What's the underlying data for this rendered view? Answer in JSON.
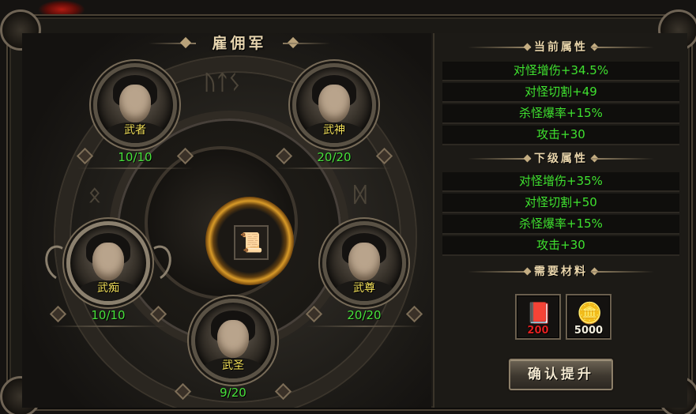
{
  "window": {
    "title": "雇佣军"
  },
  "center": {
    "item_icon": "scroll-icon"
  },
  "heroes": [
    {
      "name": "武者",
      "level": "10/10",
      "special": false
    },
    {
      "name": "武神",
      "level": "20/20",
      "special": false
    },
    {
      "name": "武痴",
      "level": "10/10",
      "special": true
    },
    {
      "name": "武尊",
      "level": "20/20",
      "special": false
    },
    {
      "name": "武圣",
      "level": "9/20",
      "special": false
    }
  ],
  "current_attrs": {
    "header": "当前属性",
    "items": [
      "对怪增伤+34.5%",
      "对怪切割+49",
      "杀怪爆率+15%",
      "攻击+30"
    ]
  },
  "next_attrs": {
    "header": "下级属性",
    "items": [
      "对怪增伤+35%",
      "对怪切割+50",
      "杀怪爆率+15%",
      "攻击+30"
    ]
  },
  "materials": {
    "header": "需要材料",
    "items": [
      {
        "icon": "card-book-icon",
        "count": "200",
        "count_color": "#e02020"
      },
      {
        "icon": "gold-ingot-icon",
        "count": "5000",
        "count_color": "#f4f0e0"
      }
    ]
  },
  "confirm_button": "确认提升",
  "colors": {
    "attr_green": "#3fe12f",
    "hero_name_yellow": "#f6e35c",
    "level_green": "#47e03a"
  }
}
